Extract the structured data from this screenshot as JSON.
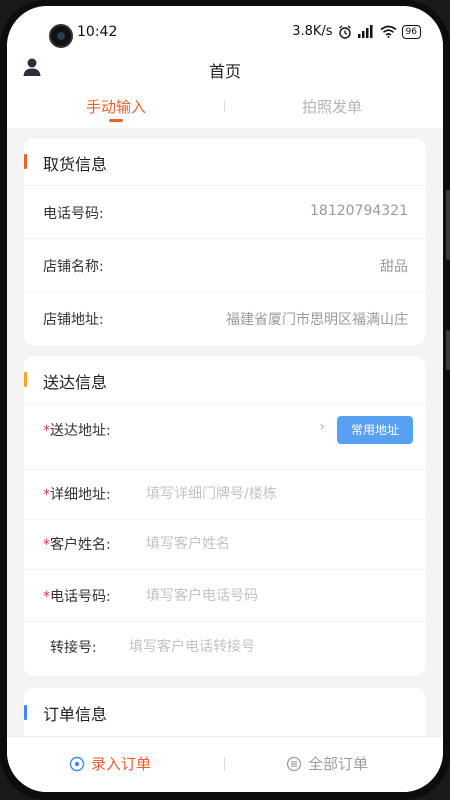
{
  "status_bar": {
    "time": "10:42",
    "net_speed": "3.8K/s",
    "battery": "96"
  },
  "header": {
    "title": "首页",
    "user_icon": "user-icon"
  },
  "tabs": [
    {
      "label": "手动输入",
      "active": true
    },
    {
      "label": "拍照发单",
      "active": false
    }
  ],
  "pickup": {
    "title": "取货信息",
    "accent": "#e8622c",
    "rows": [
      {
        "label": "电话号码:",
        "value": "18120794321"
      },
      {
        "label": "店铺名称:",
        "value": "甜品"
      },
      {
        "label": "店铺地址:",
        "value": "福建省厦门市思明区福满山庄"
      }
    ]
  },
  "delivery": {
    "title": "送达信息",
    "accent": "#f5a623",
    "address": {
      "required": "*",
      "label": "送达地址:",
      "chevron": "›",
      "button": "常用地址"
    },
    "detail": {
      "required": "*",
      "label": "详细地址:",
      "placeholder": "填写详细门牌号/楼栋"
    },
    "name": {
      "required": "*",
      "label": "客户姓名:",
      "placeholder": "填写客户姓名"
    },
    "phone": {
      "required": "*",
      "label": "电话号码:",
      "placeholder": "填写客户电话号码"
    },
    "ext": {
      "label": "转接号:",
      "placeholder": "填写客户电话转接号"
    }
  },
  "order": {
    "title": "订单信息",
    "accent": "#3d8af7"
  },
  "bottom_nav": [
    {
      "label": "录入订单",
      "icon": "record-icon",
      "active": true
    },
    {
      "label": "全部订单",
      "icon": "list-icon",
      "active": false
    }
  ],
  "colors": {
    "accent": "#e8622c",
    "button_blue": "#5aa0f2",
    "background": "#f4f4f4"
  }
}
